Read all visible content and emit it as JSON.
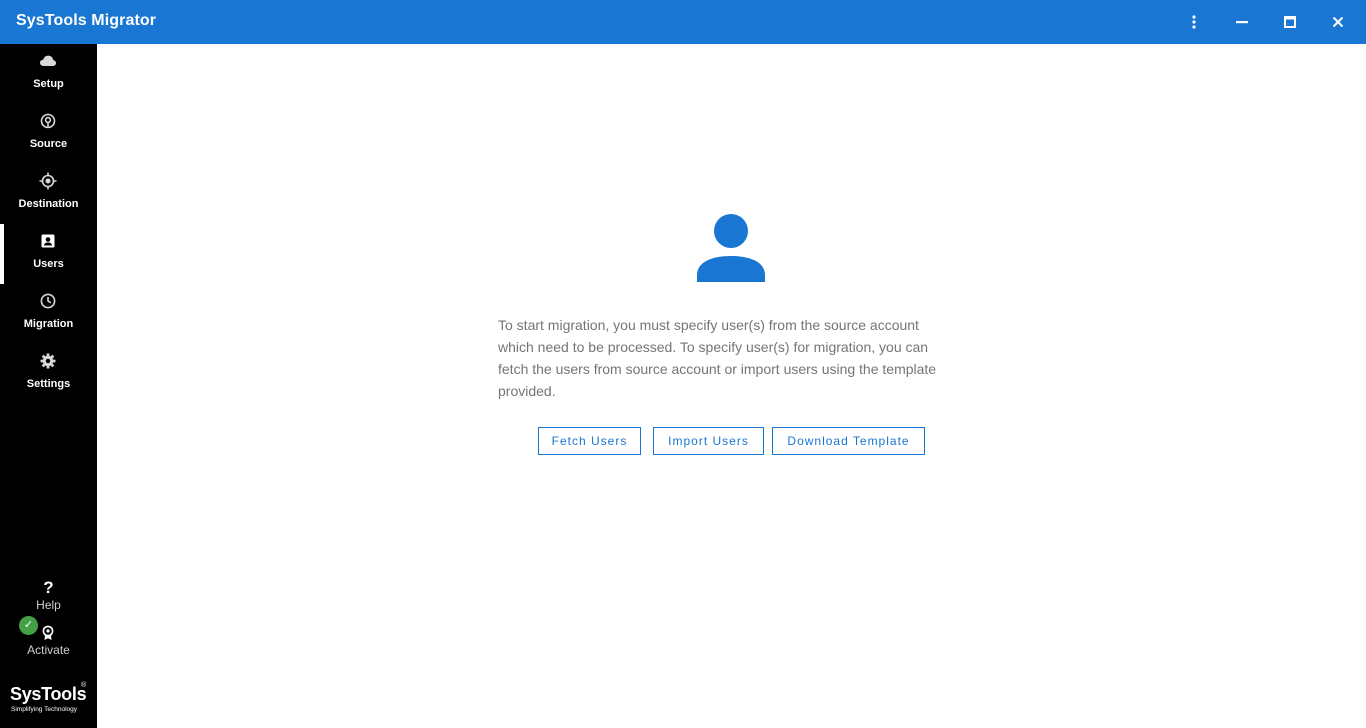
{
  "window": {
    "title": "SysTools Migrator",
    "controls": [
      "more-vert-icon",
      "minimize-icon",
      "maximize-icon",
      "close-icon"
    ]
  },
  "sidebar": {
    "items": [
      {
        "label": "Setup",
        "icon": "cloud-icon",
        "active": false
      },
      {
        "label": "Source",
        "icon": "source-icon",
        "active": false
      },
      {
        "label": "Destination",
        "icon": "target-icon",
        "active": false
      },
      {
        "label": "Users",
        "icon": "user-card-icon",
        "active": true
      },
      {
        "label": "Migration",
        "icon": "clock-icon",
        "active": false
      },
      {
        "label": "Settings",
        "icon": "gear-icon",
        "active": false
      }
    ],
    "help_label": "Help",
    "activate_label": "Activate",
    "logo_text": "SysTools",
    "logo_tagline": "Simplifying Technology"
  },
  "main": {
    "message": "To start migration, you must specify user(s) from the source account which need to be processed. To specify user(s) for migration, you can fetch the users from source account or import users using the template provided.",
    "buttons": {
      "fetch": "Fetch Users",
      "import": "Import Users",
      "download": "Download Template"
    }
  },
  "colors": {
    "titlebar": "#1976d2",
    "sidebar": "#000000",
    "accent": "#1976d2",
    "success": "#43a047"
  }
}
